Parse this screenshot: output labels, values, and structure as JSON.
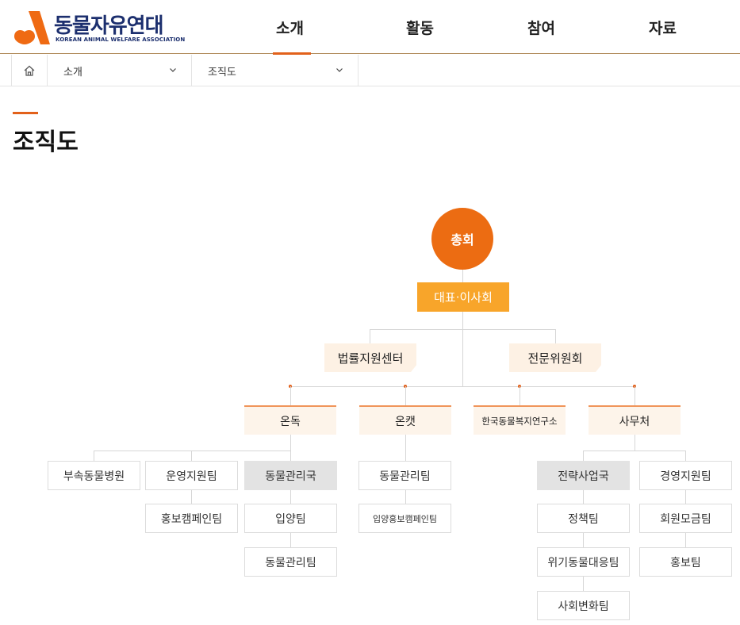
{
  "header": {
    "logo_main": "동물자유연대",
    "logo_sub": "KOREAN ANIMAL WELFARE ASSOCIATION",
    "nav": [
      "소개",
      "활동",
      "참여",
      "자료"
    ],
    "active_nav": 0,
    "accent": "#e2611b",
    "brand_navy": "#1c2f6e"
  },
  "breadcrumb": {
    "home_icon": "home-icon",
    "items": [
      "소개",
      "조직도"
    ]
  },
  "page": {
    "title": "조직도"
  },
  "org": {
    "top": "총회",
    "representative": "대표·이사회",
    "advisory": [
      "법률지원센터",
      "전문위원회"
    ],
    "departments": {
      "ondok": {
        "name": "온독",
        "units": [
          "부속동물병원",
          "운영지원팀",
          "동물관리국"
        ],
        "sub_support": [
          "홍보캠페인팀"
        ],
        "sub_animal": [
          "입양팀",
          "동물관리팀"
        ]
      },
      "oncat": {
        "name": "온캣",
        "units": [
          "동물관리팀",
          "입양홍보캠페인팀"
        ]
      },
      "institute": {
        "name": "한국동물복지연구소"
      },
      "office": {
        "name": "사무처",
        "strategy": [
          "전략사업국",
          "정책팀",
          "위기동물대응팀",
          "사회변화팀"
        ],
        "management": [
          "경영지원팀",
          "회원모금팀",
          "홍보팀"
        ]
      }
    },
    "colors": {
      "circle": "#ec6c12",
      "representative": "#f8a52a",
      "dept_border": "#f0955a"
    }
  }
}
